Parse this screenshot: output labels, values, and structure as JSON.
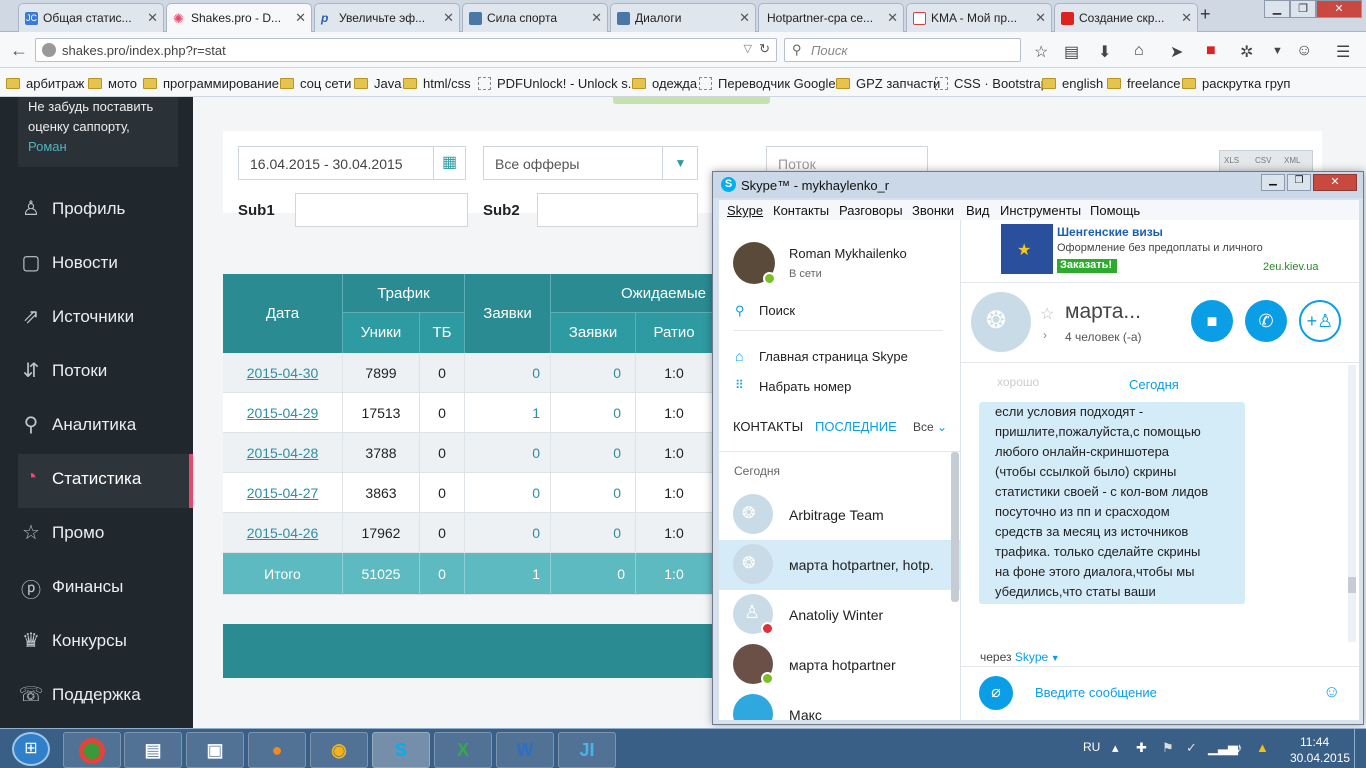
{
  "browser": {
    "tabs": [
      {
        "label": "Общая статис...",
        "icon": "jc-icon",
        "color": "#3a7bd5"
      },
      {
        "label": "Shakes.pro - D...",
        "icon": "shakes-icon",
        "color": "#e8486d"
      },
      {
        "label": "Увеличьте эф...",
        "icon": "p-icon",
        "color": "#2a5fb0"
      },
      {
        "label": "Сила спорта",
        "icon": "vk-icon",
        "color": "#4a76a8"
      },
      {
        "label": "Диалоги",
        "icon": "vk-icon",
        "color": "#4a76a8"
      },
      {
        "label": "Hotpartner-cpa се...",
        "icon": "blank-icon",
        "color": "#ffffff"
      },
      {
        "label": "KMA - Мой пр...",
        "icon": "kma-icon",
        "color": "#c44"
      },
      {
        "label": "Создание скр...",
        "icon": "screenshot-icon",
        "color": "#d22"
      }
    ],
    "url": "shakes.pro/index.php?r=stat",
    "search_placeholder": "Поиск",
    "bookmarks": [
      {
        "label": "арбитраж",
        "type": "folder"
      },
      {
        "label": "мото",
        "type": "folder"
      },
      {
        "label": "программирование",
        "type": "folder"
      },
      {
        "label": "соц сети",
        "type": "folder"
      },
      {
        "label": "Java",
        "type": "folder"
      },
      {
        "label": "html/css",
        "type": "folder"
      },
      {
        "label": "PDFUnlock! - Unlock s...",
        "type": "page"
      },
      {
        "label": "одежда",
        "type": "folder"
      },
      {
        "label": "Переводчик Google",
        "type": "page"
      },
      {
        "label": "GPZ запчасти",
        "type": "folder"
      },
      {
        "label": "CSS · Bootstrap",
        "type": "page"
      },
      {
        "label": "english",
        "type": "folder"
      },
      {
        "label": "freelance",
        "type": "folder"
      },
      {
        "label": "раскрутка груп",
        "type": "folder"
      }
    ]
  },
  "sidebar": {
    "notice_lines": [
      "Не забудь поставить",
      "оценку саппорту,"
    ],
    "notice_link": "Роман",
    "items": [
      {
        "label": "Профиль",
        "icon": "user-icon"
      },
      {
        "label": "Новости",
        "icon": "news-icon"
      },
      {
        "label": "Источники",
        "icon": "sources-icon"
      },
      {
        "label": "Потоки",
        "icon": "streams-icon"
      },
      {
        "label": "Аналитика",
        "icon": "analytics-icon"
      },
      {
        "label": "Статистика",
        "icon": "stats-icon"
      },
      {
        "label": "Промо",
        "icon": "star-icon"
      },
      {
        "label": "Финансы",
        "icon": "finance-icon"
      },
      {
        "label": "Конкурсы",
        "icon": "trophy-icon"
      },
      {
        "label": "Поддержка",
        "icon": "support-icon"
      }
    ],
    "active": "Статистика"
  },
  "filters": {
    "date_range": "16.04.2015 - 30.04.2015",
    "offers": "Все офферы",
    "stream_placeholder": "Поток",
    "sub1_label": "Sub1",
    "sub2_label": "Sub2",
    "export": [
      "XLS",
      "CSV",
      "XML"
    ]
  },
  "table": {
    "headers": {
      "date": "Дата",
      "traffic": "Трафик",
      "uniques": "Уники",
      "tb": "ТБ",
      "requests": "Заявки",
      "expected": "Ожидаемые",
      "exp_requests": "Заявки",
      "ratio": "Ратио"
    },
    "rows": [
      {
        "date": "2015-04-30",
        "uniques": "7899",
        "tb": "0",
        "requests": "0",
        "exp_requests": "0",
        "ratio": "1:0"
      },
      {
        "date": "2015-04-29",
        "uniques": "17513",
        "tb": "0",
        "requests": "1",
        "exp_requests": "0",
        "ratio": "1:0"
      },
      {
        "date": "2015-04-28",
        "uniques": "3788",
        "tb": "0",
        "requests": "0",
        "exp_requests": "0",
        "ratio": "1:0"
      },
      {
        "date": "2015-04-27",
        "uniques": "3863",
        "tb": "0",
        "requests": "0",
        "exp_requests": "0",
        "ratio": "1:0"
      },
      {
        "date": "2015-04-26",
        "uniques": "17962",
        "tb": "0",
        "requests": "0",
        "exp_requests": "0",
        "ratio": "1:0"
      }
    ],
    "total": {
      "label": "Итого",
      "uniques": "51025",
      "tb": "0",
      "requests": "1",
      "exp_requests": "0",
      "ratio": "1:0"
    }
  },
  "skype": {
    "title": "Skype™ - mykhaylenko_r",
    "menu": [
      "Skype",
      "Контакты",
      "Разговоры",
      "Звонки",
      "Вид",
      "Инструменты",
      "Помощь"
    ],
    "profile_name": "Roman Mykhailenko",
    "profile_status": "В сети",
    "search": "Поиск",
    "home": "Главная страница Skype",
    "dial": "Набрать номер",
    "tab_contacts": "КОНТАКТЫ",
    "tab_recent": "ПОСЛЕДНИЕ",
    "filter": "Все",
    "today": "Сегодня",
    "contacts": [
      {
        "name": "Arbitrage Team",
        "status": "group"
      },
      {
        "name": "марта hotpartner, hotp.",
        "status": "group"
      },
      {
        "name": "Anatoliy Winter",
        "status": "busy"
      },
      {
        "name": "марта hotpartner",
        "status": "online"
      },
      {
        "name": "Макс",
        "status": "online"
      }
    ],
    "ad_title": "Шенгенские визы",
    "ad_text": "Оформление без предоплаты и личного",
    "ad_button": "Заказать!",
    "ad_site": "2eu.kiev.ua",
    "chat_title": "марта...",
    "chat_members": "4 человек (-а)",
    "chat_day": "Сегодня",
    "chat_faded": "хорошо",
    "message_lines": [
      "если условия подходят -",
      "пришлите,пожалуйста,с помощью",
      "любого онлайн-скриншотера",
      "(чтобы ссылкой было) скрины",
      "статистики своей - с кол-вом лидов",
      "посуточно из пп и срасходом",
      "средств за месяц из источников",
      "трафика. только сделайте скрины",
      "на фоне этого диалога,чтобы мы",
      "убедились,что статы ваши"
    ],
    "via": "через",
    "via_link": "Skype",
    "input_placeholder": "Введите сообщение"
  },
  "taskbar": {
    "lang": "RU",
    "time": "11:44",
    "date": "30.04.2015"
  },
  "colors": {
    "table_header": "#2a8b92",
    "table_total": "#5dbac1",
    "sidebar_bg": "#21282d",
    "active_marker": "#e8486d",
    "skype_blue": "#0a9ee6"
  }
}
